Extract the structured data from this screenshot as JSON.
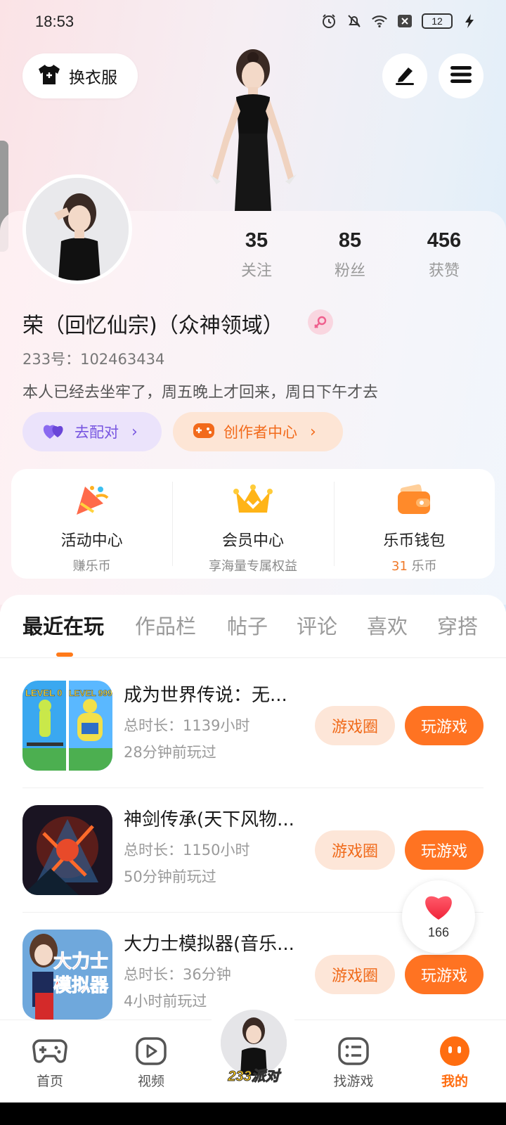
{
  "status_bar": {
    "time": "18:53",
    "battery": "12",
    "icons": [
      "alarm-icon",
      "mute-icon",
      "wifi-icon",
      "sim-off-icon",
      "battery-icon",
      "charging-icon"
    ]
  },
  "header": {
    "wardrobe_label": "换衣服",
    "edit_icon": "pen-icon",
    "menu_icon": "hamburger-icon"
  },
  "profile": {
    "stats": [
      {
        "value": "35",
        "label": "关注"
      },
      {
        "value": "85",
        "label": "粉丝"
      },
      {
        "value": "456",
        "label": "获赞"
      }
    ],
    "name": "荣（回忆仙宗)（众神领域）",
    "user_id": "233号：102463434",
    "bio": "本人已经去坐牢了，周五晚上才回来，周日下午才去",
    "match_label": "去配对",
    "creator_label": "创作者中心"
  },
  "quick_cards": [
    {
      "title": "活动中心",
      "sub": "赚乐币"
    },
    {
      "title": "会员中心",
      "sub": "享海量专属权益"
    },
    {
      "title": "乐币钱包",
      "sub_value": "31",
      "sub_unit": " 乐币"
    }
  ],
  "tabs": [
    "最近在玩",
    "作品栏",
    "帖子",
    "评论",
    "喜欢",
    "穿搭"
  ],
  "games": [
    {
      "title": "成为世界传说：无...",
      "duration": "总时长：1139小时",
      "last_played": "28分钟前玩过",
      "circle_label": "游戏圈",
      "play_label": "玩游戏"
    },
    {
      "title": "神剑传承(天下风物...",
      "duration": "总时长：1150小时",
      "last_played": "50分钟前玩过",
      "circle_label": "游戏圈",
      "play_label": "玩游戏"
    },
    {
      "title": "大力士模拟器(音乐...",
      "duration": "总时长：36分钟",
      "last_played": "4小时前玩过",
      "circle_label": "游戏圈",
      "play_label": "玩游戏"
    }
  ],
  "game_thumb_texts": {
    "g1_left": "LEVEL 0",
    "g1_right": "LEVEL 999",
    "g3_line1": "大力士",
    "g3_line2": "模拟器"
  },
  "like_float": {
    "count": "166"
  },
  "bottom_nav": [
    {
      "label": "首页"
    },
    {
      "label": "视频"
    },
    {
      "label": "233派对"
    },
    {
      "label": "找游戏"
    },
    {
      "label": "我的"
    }
  ],
  "colors": {
    "accent_orange": "#ff7322",
    "match_purple": "#7755e0",
    "tab_indicator": "#ff7a1a"
  }
}
